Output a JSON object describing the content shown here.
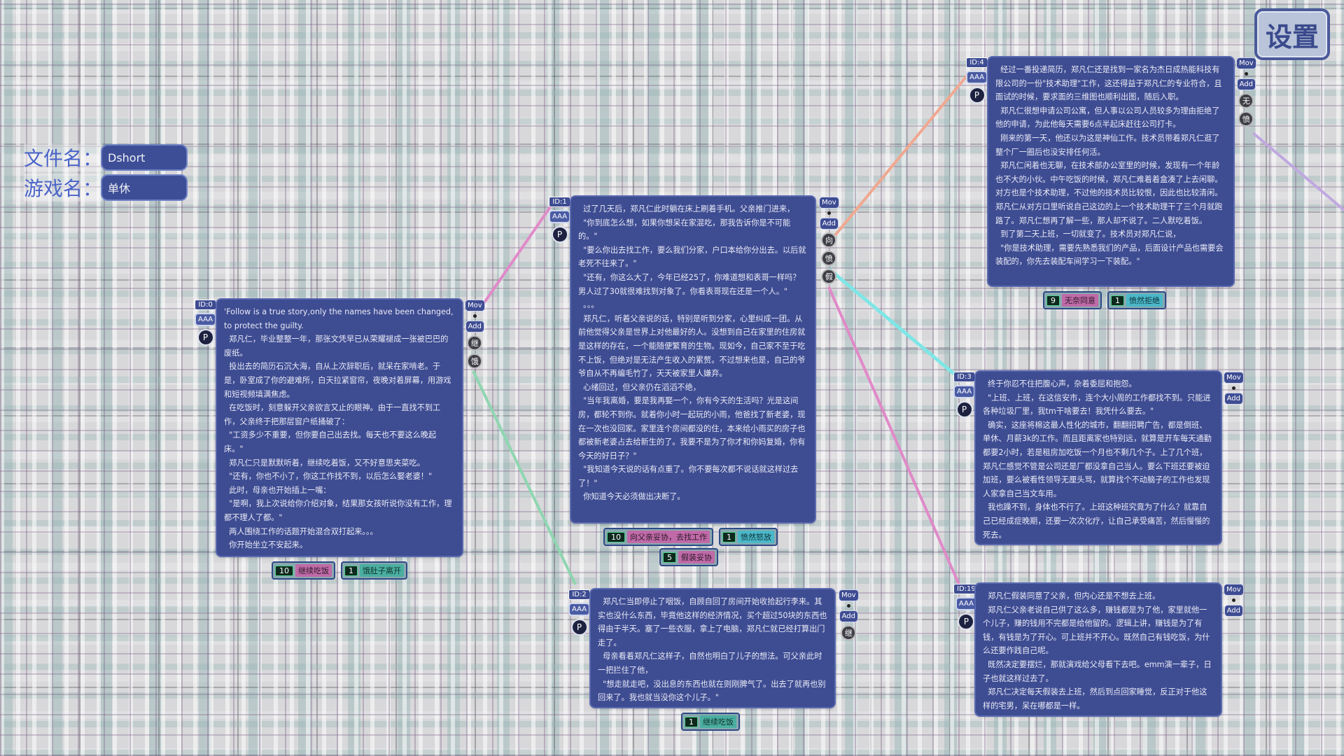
{
  "settings_label": "设置",
  "file": {
    "label": "文件名：",
    "value": "Dshort"
  },
  "game": {
    "label": "游戏名：",
    "value": "单休"
  },
  "colors": {
    "node_bg": "#3e4c92",
    "link_pink": "#e08ac8",
    "link_cyan": "#7fe6e6",
    "link_green": "#8fd6b0",
    "link_salmon": "#f0a890",
    "link_lavender": "#c0a8e0"
  },
  "common": {
    "aaa": "AAA",
    "p": "P",
    "mov": "Mov",
    "add": "Add"
  },
  "nodes": [
    {
      "id": "ID:0",
      "glyphs": [
        "继",
        "饿"
      ],
      "text": "'Follow is a true story,only the names have been changed, to protect the guilty.\n  郑凡仁，毕业整整一年，那张文凭早已从荣耀褪成一张被巴巴的废纸。\n  投出去的简历石沉大海，自从上次辞职后，就呆在家啃老。于是，卧室成了你的避难所，白天拉紧窗帘，夜晚对着屏幕，用游戏和短视频填满焦虑。\n  在吃饭时，刻意躲开父亲欲言又止的眼神。由于一直找不到工作，父亲终于把那层窗户纸捅破了：\n  \"工资多少不重要，但你要自己出去找。每天也不要这么晚起床。\"\n  郑凡仁只是默默听着，继续吃着饭，又不好意思夹菜吃。\n  \"还有，你也不小了，你这工作找不到，以后怎么娶老婆！\"\n  此时，母亲也开始插上一嘴：\n  \"是啊，我上次说给你介绍对象，结果那女孩听说你没有工作，理都不理人了都。\"\n  两人围绕工作的话题开始混合双打起来。。。\n  你开始坐立不安起来。",
      "choices": [
        {
          "weight": "10",
          "label": "继续吃饭",
          "tone": "pink"
        },
        {
          "weight": "1",
          "label": "饿肚子离开",
          "tone": "green"
        }
      ]
    },
    {
      "id": "ID:1",
      "glyphs": [
        "向",
        "愤",
        "假"
      ],
      "text": "  过了几天后，郑凡仁此时躺在床上刷着手机。父亲推门进来，\n  \"你到底怎么想，如果你想呆在家混吃，那我告诉你是不可能的。\"\n  \"要么你出去找工作，要么我们分家，户口本给你分出去。以后就老死不往来了。\"\n  \"还有，你这么大了，今年已经25了，你难道想和表哥一样吗？男人过了30就很难找到对象了。你看表哥现在还是一个人。\"\n  。。。\n  郑凡仁，听着父亲说的话，特别是听到分家，心里纠成一团。从前他觉得父亲是世界上对他最好的人。没想到自己在家里的住房就是这样的存在，一个能随便繁育的生物。现如今，自己家不至于吃不上饭，但绝对是无法产生收入的累赘。不过想来也是，自己的爷爷自从不再编毛竹了，天天被家里人嫌弃。\n  心绪回过，但父亲仍在滔滔不绝，\n  \"当年我离婚，要是我再娶一个，你有今天的生活吗？光是这间房，都轮不到你。就着你小时一起玩的小雨，他爸找了新老婆，现在一次也没回家。家里连个房间都没的住，本来给小雨买的房子也都被新老婆占去给新生的了。我要不是为了你才和你妈复婚，你有今天的好日子？\"\n  \"我知道今天说的话有点重了。你不要每次都不说话就这样过去了！\"\n  你知道今天必须做出决断了。",
      "choices": [
        {
          "weight": "10",
          "label": "向父亲妥协，去找工作",
          "tone": "pink"
        },
        {
          "weight": "1",
          "label": "愤然怒放",
          "tone": "cyan"
        }
      ],
      "extra_choice": {
        "weight": "5",
        "label": "假装妥协",
        "tone": "pink"
      }
    },
    {
      "id": "ID:2",
      "glyphs": [
        "继"
      ],
      "text": "  郑凡仁当即停止了咽饭，自顾自回了房间开始收拾起行李来。其实也没什么东西，毕竟他这样的经济情况，买个超过50块的东西也得由于半天。塞了一些衣服，拿上了电脑，郑凡仁就已经打算出门走了。\n  母亲看着郑凡仁这样子，自然也明白了儿子的想法。可父亲此时一把拦住了他，\n  \"想走就走吧，没出息的东西也就在则刚脾气了。出去了就再也别回来了。我也就当没你这个儿子。\"",
      "choices": [
        {
          "weight": "1",
          "label": "继续吃饭",
          "tone": "green"
        }
      ]
    },
    {
      "id": "ID:3",
      "glyphs": [],
      "text": "  终于你忍不住把腹心声，杂着委屈和抱怨。\n  \"上班、上班，在这信安市，连个大小周的工作都找不到。只能进各种垃圾厂里，我tm干啥要去！我凭什么要去。\"\n  确实，这座将棉这最人性化的城市，翻翻招聘广告，都是倒班、单休、月薪3k的工作。而且距离家也特别远，就算是开车每天通勤都要2小时，若是租房加吃饭一个月也不剩几个子。上了几个班，郑凡仁感觉不管是公司还是厂都没拿自己当人。要么下班还要被迫加班，要么被看性领导无厘头骂，就算找个不动脑子的工作也发现人家拿自己当文车用。\n  我也躁不到，身体也不行了。上班这种班究竟为了什么？就靠自己已经成症晚期，还要一次次化疗，让自己承受痛苦，然后慢慢的死去。",
      "choices": []
    },
    {
      "id": "ID:4",
      "glyphs": [
        "无",
        "愤"
      ],
      "text": "  经过一番投递简历，郑凡仁还是找到一家名为杰日成热能科技有限公司的一份\"技术助理\"工作，这还得益于郑凡仁的专业符合，且面试的时候，要求面的三维图也顺利出图，随后入职。\n  郑凡仁很想申请公司公寓，但人事以公司人员较多为理由拒绝了他的申请，为此他每天需要6点半起床赶往公司打卡。\n  刚来的第一天，他还以为这是神仙工作。技术员带着郑凡仁逛了整个厂一圈后也没安排任何活。\n  郑凡仁闲着也无聊，在技术部办公室里的时候，发现有一个年龄也不大的小伙。中午吃饭的时候，郑凡仁难着着盒凑了上去闲聊。对方也是个技术助理，不过他的技术员比较恨，因此也比较清闲。郑凡仁从对方口里听说自己这边的上一个技术助理干了三个月就跑路了。郑凡仁想再了解一些，那人却不说了。二人默吃着饭。\n  到了第二天上班，一切就变了。技术员对郑凡仁说，\n  \"你是技术助理，需要先熟悉我们的产品，后面设计产品也需要会装配的，你先去装配车间学习一下装配。\"",
      "choices": [
        {
          "weight": "9",
          "label": "无奈同意",
          "tone": "pink"
        },
        {
          "weight": "1",
          "label": "愤然拒绝",
          "tone": "cyan"
        }
      ]
    },
    {
      "id": "ID:19",
      "glyphs": [],
      "text": "  郑凡仁假装同意了父亲，但内心还是不想去上班。\n  郑凡仁父亲老说自己供了这么多，赚钱都是为了他，家里就他一个儿子，赚的钱用不完都是给他留的。逻辑上讲，赚钱是为了有钱，有钱是为了开心。可上班并不开心。既然自己有钱吃饭，为什么还要作践自己呢。\n  既然决定要摆烂，那就演戏给父母看下去吧。emm演一辈子，日子也就这样过去了。\n  郑凡仁决定每天假装去上班，然后到点回家睡觉，反正对于他这样的宅男，呆在哪都是一样。",
      "choices": []
    }
  ]
}
